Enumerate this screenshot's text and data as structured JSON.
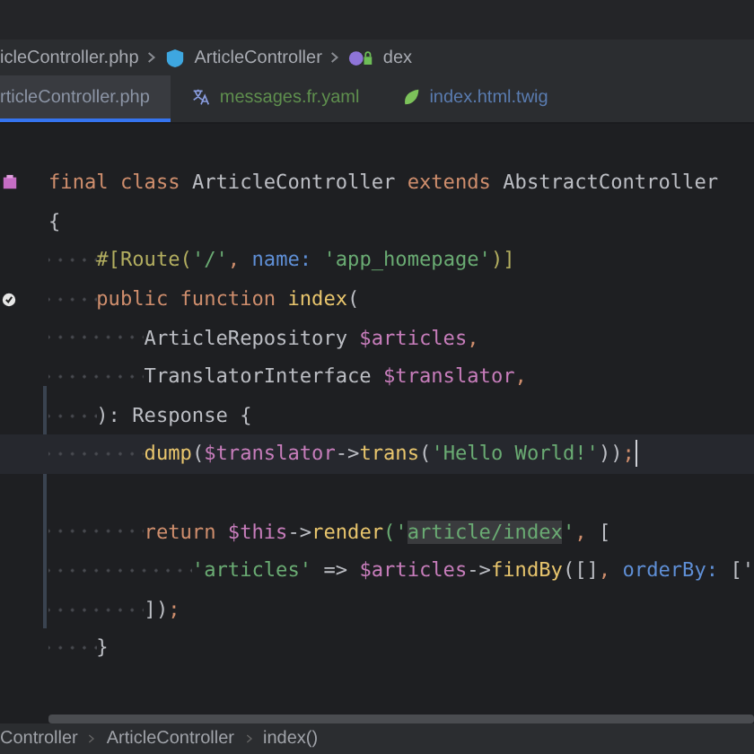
{
  "breadcrumb": [
    {
      "text": "icleController.php",
      "kind": "file"
    },
    {
      "text": "ArticleController",
      "kind": "class"
    },
    {
      "text": "dex",
      "kind": "method"
    }
  ],
  "tabs": [
    {
      "label": "rticleController.php",
      "kind": "php",
      "selected": true,
      "color": "#8c95a6"
    },
    {
      "label": "messages.fr.yaml",
      "kind": "translation",
      "selected": false,
      "color": "#5f8f4e"
    },
    {
      "label": "index.html.twig",
      "kind": "twig",
      "selected": false,
      "color": "#5a7cb0"
    }
  ],
  "editor": {
    "lines": [
      {
        "kind": "class_declaration",
        "current": false,
        "tokens": [
          {
            "text": "final class ",
            "kind": "kw"
          },
          {
            "text": "ArticleController ",
            "kind": "plain"
          },
          {
            "text": "extends ",
            "kind": "kw"
          },
          {
            "text": "AbstractController",
            "kind": "plain"
          }
        ]
      },
      {
        "kind": "code",
        "current": false,
        "tokens": [
          {
            "text": "{",
            "kind": "plain"
          }
        ],
        "children": [
          {
            "kind": "code",
            "current": false,
            "tokens": [
              {
                "text": "#[Route(",
                "kind": "attr"
              },
              {
                "text": "'/'",
                "kind": "str"
              },
              {
                "text": ", ",
                "kind": "kw"
              },
              {
                "text": "name: ",
                "kind": "named"
              },
              {
                "text": "'app_homepage'",
                "kind": "str"
              },
              {
                "text": ")]",
                "kind": "attr"
              }
            ]
          },
          {
            "kind": "method_declaration",
            "current": false,
            "tokens": [
              {
                "text": "public function ",
                "kind": "kw"
              },
              {
                "text": "index",
                "kind": "fn"
              },
              {
                "text": "(",
                "kind": "plain"
              }
            ],
            "children": [
              {
                "kind": "code",
                "current": false,
                "tokens": [
                  {
                    "text": "ArticleRepository ",
                    "kind": "plain"
                  },
                  {
                    "text": "$articles",
                    "kind": "var"
                  },
                  {
                    "text": ",",
                    "kind": "kw"
                  }
                ]
              },
              {
                "kind": "code",
                "current": false,
                "tokens": [
                  {
                    "text": "TranslatorInterface ",
                    "kind": "plain"
                  },
                  {
                    "text": "$translator",
                    "kind": "var"
                  },
                  {
                    "text": ",",
                    "kind": "kw"
                  }
                ]
              }
            ]
          },
          {
            "kind": "code",
            "current": false,
            "tokens": [
              {
                "text": "): Response {",
                "kind": "plain"
              }
            ],
            "children": [
              {
                "kind": "code",
                "current": true,
                "caret": true,
                "tokens": [
                  {
                    "text": "dump",
                    "kind": "fn"
                  },
                  {
                    "text": "(",
                    "kind": "plain"
                  },
                  {
                    "text": "$translator",
                    "kind": "var"
                  },
                  {
                    "text": "->",
                    "kind": "plain"
                  },
                  {
                    "text": "trans",
                    "kind": "fn"
                  },
                  {
                    "text": "(",
                    "kind": "plain"
                  },
                  {
                    "text": "'Hello World!'",
                    "kind": "str"
                  },
                  {
                    "text": "))",
                    "kind": "plain"
                  },
                  {
                    "text": ";",
                    "kind": "kw"
                  }
                ]
              },
              {
                "kind": "blank",
                "current": false
              },
              {
                "kind": "code",
                "current": false,
                "tokens": [
                  {
                    "text": "return ",
                    "kind": "kw"
                  },
                  {
                    "text": "$this",
                    "kind": "var"
                  },
                  {
                    "text": "->",
                    "kind": "plain"
                  },
                  {
                    "text": "render",
                    "kind": "fn"
                  },
                  {
                    "text": "('",
                    "kind": "str"
                  },
                  {
                    "text": "article/index",
                    "kind": "match"
                  },
                  {
                    "text": "'",
                    "kind": "str"
                  },
                  {
                    "text": ", ",
                    "kind": "kw"
                  },
                  {
                    "text": "[",
                    "kind": "plain"
                  }
                ],
                "children": [
                  {
                    "kind": "code",
                    "current": false,
                    "tokens": [
                      {
                        "text": "'articles'",
                        "kind": "str"
                      },
                      {
                        "text": " => ",
                        "kind": "plain"
                      },
                      {
                        "text": "$articles",
                        "kind": "var"
                      },
                      {
                        "text": "->",
                        "kind": "plain"
                      },
                      {
                        "text": "findBy",
                        "kind": "fn"
                      },
                      {
                        "text": "([]",
                        "kind": "plain"
                      },
                      {
                        "text": ", ",
                        "kind": "kw"
                      },
                      {
                        "text": "orderBy: ",
                        "kind": "named"
                      },
                      {
                        "text": "['",
                        "kind": "plain"
                      }
                    ]
                  }
                ]
              },
              {
                "kind": "code",
                "current": false,
                "tokens": [
                  {
                    "text": "])",
                    "kind": "plain"
                  },
                  {
                    "text": ";",
                    "kind": "kw"
                  }
                ]
              }
            ]
          },
          {
            "kind": "code",
            "current": false,
            "tokens": [
              {
                "text": "}",
                "kind": "plain"
              }
            ]
          }
        ]
      }
    ]
  },
  "status_bar": {
    "path": [
      "Controller",
      "ArticleController",
      "index()"
    ]
  }
}
